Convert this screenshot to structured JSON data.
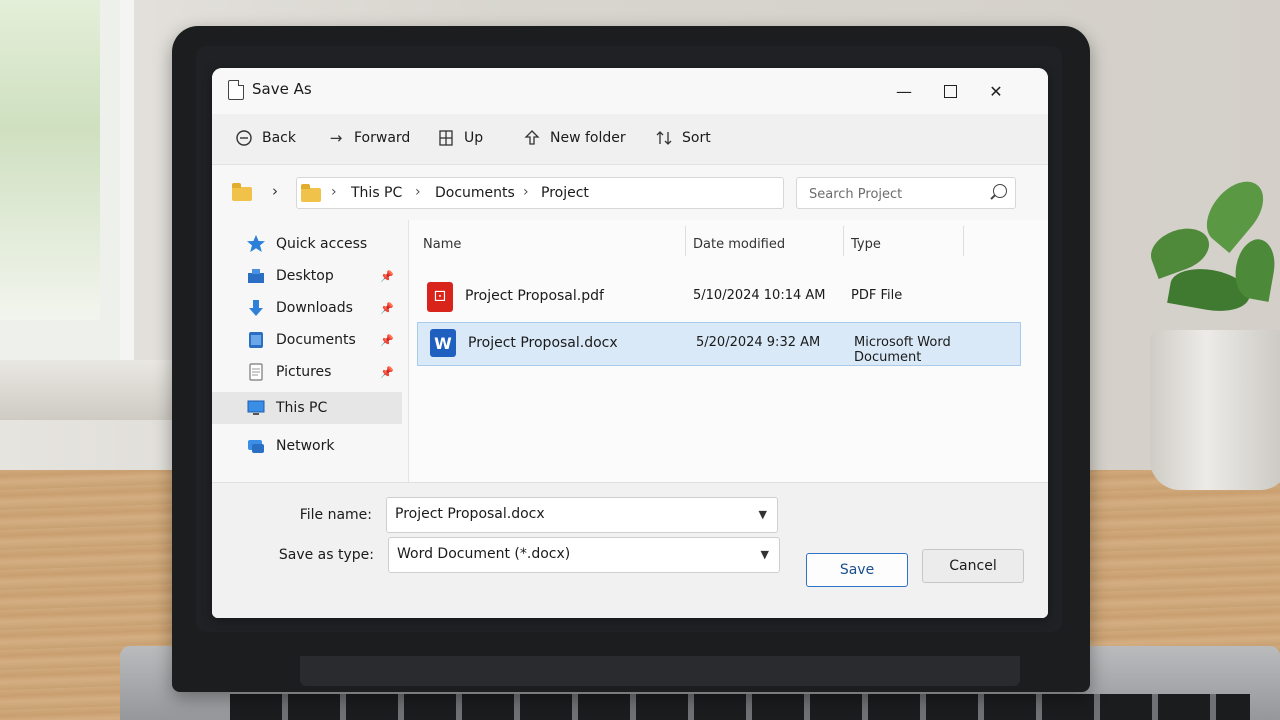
{
  "dialog": {
    "title": "Save As"
  },
  "toolbar": {
    "back": "Back",
    "forward": "Forward",
    "up": "Up",
    "new_folder": "New folder",
    "sort": "Sort"
  },
  "address": {
    "crumbs": [
      "This PC",
      "Documents",
      "Project"
    ]
  },
  "search": {
    "placeholder": "Search Project"
  },
  "nav": {
    "items": [
      {
        "label": "Quick access",
        "icon": "star-icon"
      },
      {
        "label": "Desktop",
        "icon": "desktop-icon",
        "pinned": true
      },
      {
        "label": "Downloads",
        "icon": "download-arrow-icon",
        "pinned": true
      },
      {
        "label": "Documents",
        "icon": "documents-icon",
        "pinned": true
      },
      {
        "label": "Pictures",
        "icon": "pictures-icon",
        "pinned": true
      },
      {
        "label": "This PC",
        "icon": "computer-icon",
        "selected": true
      },
      {
        "label": "Network",
        "icon": "network-icon"
      }
    ]
  },
  "files": {
    "columns": [
      "Name",
      "Date modified",
      "Type"
    ],
    "rows": [
      {
        "name": "Project Proposal.pdf",
        "date": "5/10/2024 10:14 AM",
        "type": "PDF File",
        "icon": "pdf-icon"
      },
      {
        "name": "Project Proposal.docx",
        "date": "5/20/2024 9:32 AM",
        "type": "Microsoft Word Document",
        "icon": "word-icon",
        "selected": true
      }
    ]
  },
  "bottom": {
    "file_name_label": "File name:",
    "file_name_value": "Project Proposal.docx",
    "type_label": "Save as type:",
    "type_value": "Word Document (*.docx)",
    "save": "Save",
    "cancel": "Cancel"
  },
  "colors": {
    "accent": "#2f73c8",
    "selection": "#d9e9f8",
    "folder": "#f1c24a"
  }
}
